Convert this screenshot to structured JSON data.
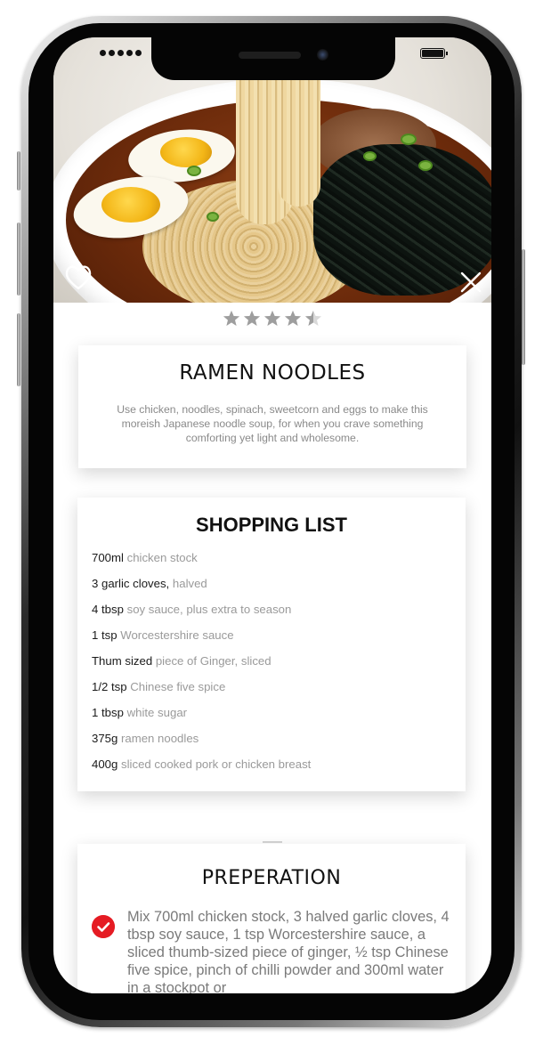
{
  "rating": {
    "value": 4.5,
    "max": 5
  },
  "recipe": {
    "title": "RAMEN NOODLES",
    "description": "Use chicken, noodles, spinach, sweetcorn and eggs to make this moreish Japanese noodle soup, for when you crave something comforting yet light and wholesome."
  },
  "shopping_list": {
    "title": "SHOPPING LIST",
    "items": [
      {
        "qty": "700ml",
        "item": "chicken stock"
      },
      {
        "qty": "3 garlic cloves,",
        "item": "halved"
      },
      {
        "qty": "4 tbsp",
        "item": "soy sauce, plus extra to season"
      },
      {
        "qty": "1 tsp",
        "item": "Worcestershire sauce"
      },
      {
        "qty": "Thum sized",
        "item": "piece of Ginger, sliced"
      },
      {
        "qty": "1/2 tsp",
        "item": "Chinese five spice"
      },
      {
        "qty": "1 tbsp",
        "item": "white sugar"
      },
      {
        "qty": "375g",
        "item": "ramen noodles"
      },
      {
        "qty": "400g",
        "item": "sliced cooked pork or chicken breast"
      }
    ]
  },
  "preparation": {
    "title": "PREPERATION",
    "step_text": "Mix 700ml chicken stock, 3 halved garlic cloves, 4 tbsp soy sauce, 1 tsp Worcestershire sauce, a sliced thumb-sized piece of ginger, ½ tsp Chinese five spice, pinch of chilli powder and 300ml water in a stockpot or",
    "step_done": true
  },
  "colors": {
    "accent": "#e51b23",
    "star": "#9e9e9e",
    "text_muted": "#8a8a8a"
  },
  "icons": {
    "favorite": "heart-outline-icon",
    "close": "close-icon",
    "check": "check-circle-icon"
  }
}
